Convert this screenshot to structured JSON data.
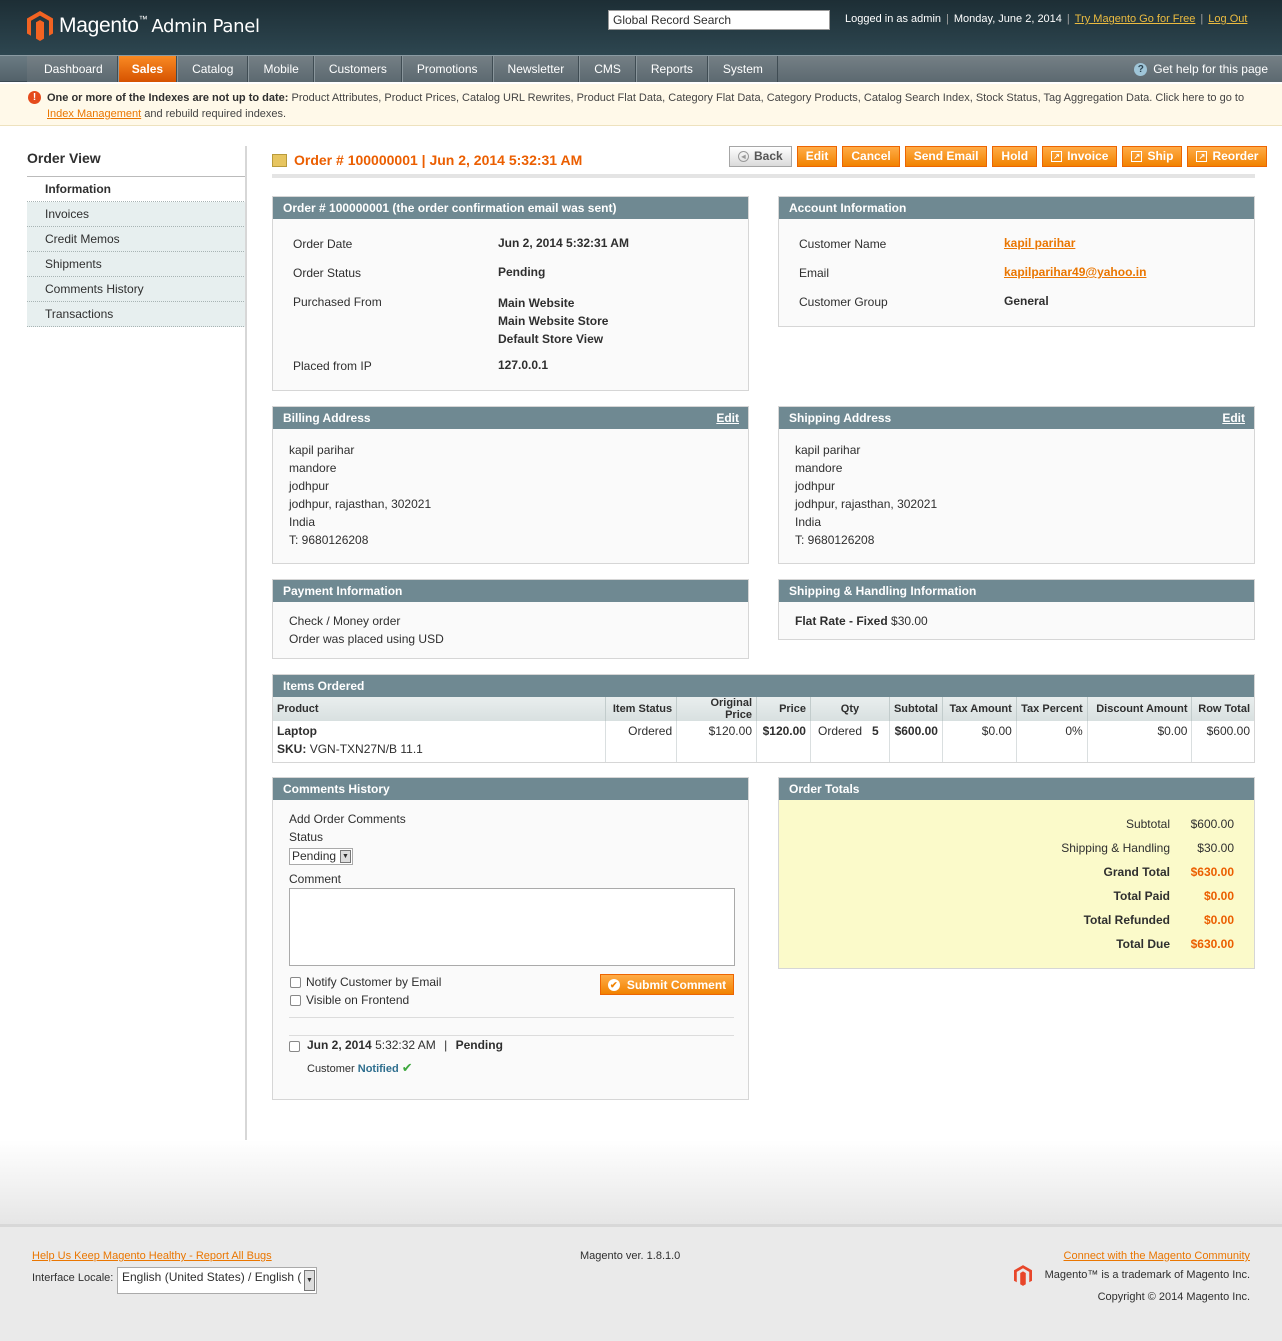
{
  "header": {
    "brand": "Magento",
    "brand_sub": "Admin Panel",
    "search_value": "Global Record Search",
    "logged_in": "Logged in as admin",
    "date": "Monday, June 2, 2014",
    "try_link": "Try Magento Go for Free",
    "logout": "Log Out"
  },
  "nav": {
    "items": [
      "Dashboard",
      "Sales",
      "Catalog",
      "Mobile",
      "Customers",
      "Promotions",
      "Newsletter",
      "CMS",
      "Reports",
      "System"
    ],
    "active": "Sales",
    "help": "Get help for this page"
  },
  "notice": {
    "bold": "One or more of the Indexes are not up to date:",
    "text": " Product Attributes, Product Prices, Catalog URL Rewrites, Product Flat Data, Category Flat Data, Category Products, Catalog Search Index, Stock Status, Tag Aggregation Data. Click here to go to ",
    "link": "Index Management",
    "tail": " and rebuild required indexes."
  },
  "sidebar": {
    "title": "Order View",
    "tabs": [
      "Information",
      "Invoices",
      "Credit Memos",
      "Shipments",
      "Comments History",
      "Transactions"
    ]
  },
  "page": {
    "title": "Order # 100000001 | Jun 2, 2014 5:32:31 AM",
    "buttons": [
      "Back",
      "Edit",
      "Cancel",
      "Send Email",
      "Hold",
      "Invoice",
      "Ship",
      "Reorder"
    ]
  },
  "order": {
    "head": "Order # 100000001 (the order confirmation email was sent)",
    "date_label": "Order Date",
    "date": "Jun 2, 2014 5:32:31 AM",
    "status_label": "Order Status",
    "status": "Pending",
    "from_label": "Purchased From",
    "from1": "Main Website",
    "from2": "Main Website Store",
    "from3": "Default Store View",
    "ip_label": "Placed from IP",
    "ip": "127.0.0.1"
  },
  "account": {
    "head": "Account Information",
    "name_label": "Customer Name",
    "name": "kapil parihar",
    "email_label": "Email",
    "email": "kapilparihar49@yahoo.in",
    "group_label": "Customer Group",
    "group": "General"
  },
  "billing": {
    "head": "Billing Address",
    "edit": "Edit",
    "lines": [
      "kapil parihar",
      "mandore",
      "jodhpur",
      "jodhpur, rajasthan, 302021",
      "India",
      "T: 9680126208"
    ]
  },
  "shipping": {
    "head": "Shipping Address",
    "edit": "Edit",
    "lines": [
      "kapil parihar",
      "mandore",
      "jodhpur",
      "jodhpur, rajasthan, 302021",
      "India",
      "T: 9680126208"
    ]
  },
  "payment": {
    "head": "Payment Information",
    "line1": "Check / Money order",
    "line2": "Order was placed using USD"
  },
  "shipping_method": {
    "head": "Shipping & Handling Information",
    "method": "Flat Rate - Fixed",
    "price": "$30.00"
  },
  "items": {
    "head": "Items Ordered",
    "columns": [
      "Product",
      "Item Status",
      "Original Price",
      "Price",
      "Qty",
      "Subtotal",
      "Tax Amount",
      "Tax Percent",
      "Discount Amount",
      "Row Total"
    ],
    "row": {
      "name": "Laptop",
      "sku_label": "SKU:",
      "sku": "VGN-TXN27N/B 11.1",
      "status": "Ordered",
      "original_price": "$120.00",
      "price": "$120.00",
      "qty_label": "Ordered",
      "qty": "5",
      "subtotal": "$600.00",
      "tax_amount": "$0.00",
      "tax_percent": "0%",
      "discount": "$0.00",
      "row_total": "$600.00"
    }
  },
  "comments": {
    "head": "Comments History",
    "add": "Add Order Comments",
    "status_label": "Status",
    "status_value": "Pending",
    "comment_label": "Comment",
    "notify": "Notify Customer by Email",
    "visible": "Visible on Frontend",
    "submit": "Submit Comment",
    "entry_date": "Jun 2, 2014",
    "entry_time": "5:32:32 AM",
    "entry_sep": "|",
    "entry_status": "Pending",
    "customer": "Customer",
    "notified": "Notified"
  },
  "totals": {
    "head": "Order Totals",
    "subtotal_label": "Subtotal",
    "subtotal": "$600.00",
    "shipping_label": "Shipping & Handling",
    "shipping": "$30.00",
    "grand_label": "Grand Total",
    "grand": "$630.00",
    "paid_label": "Total Paid",
    "paid": "$0.00",
    "refunded_label": "Total Refunded",
    "refunded": "$0.00",
    "due_label": "Total Due",
    "due": "$630.00"
  },
  "footer": {
    "bugs": "Help Us Keep Magento Healthy - Report All Bugs",
    "locale_label": "Interface Locale:",
    "locale_value": "English (United States) / English (",
    "version": "Magento ver. 1.8.1.0",
    "community": "Connect with the Magento Community",
    "trademark": "Magento™ is a trademark of Magento Inc.",
    "copyright": "Copyright © 2014 Magento Inc."
  },
  "colors": {
    "accent": "#eb5e00",
    "header": "#2d4650",
    "box_head": "#6f8992"
  }
}
